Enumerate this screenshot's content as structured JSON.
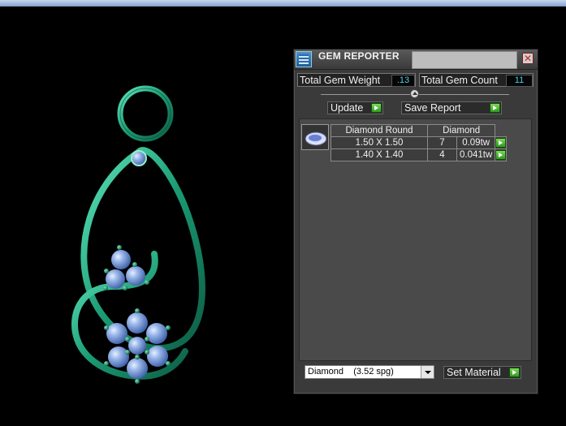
{
  "window": {
    "title": "GEM REPORTER",
    "close_glyph": "✕"
  },
  "stats": {
    "weight_label": "Total Gem Weight",
    "weight_value": ".13",
    "count_label": "Total Gem Count",
    "count_value": "11"
  },
  "toolbar": {
    "update_label": "Update",
    "save_report_label": "Save Report"
  },
  "gem_table": {
    "headers": [
      "Diamond Round",
      "Diamond"
    ],
    "rows": [
      {
        "size": "1.50 X 1.50",
        "count": "7",
        "weight": "0.09tw"
      },
      {
        "size": "1.40 X 1.40",
        "count": "4",
        "weight": "0.041tw"
      }
    ]
  },
  "material": {
    "selected": "Diamond    (3.52 spg)",
    "set_label": "Set Material"
  },
  "icons": [
    "gem-reporter-app-icon",
    "close-icon",
    "arrow-right-icon",
    "slider-knob-icon",
    "round-diamond-icon",
    "dropdown-arrow-icon"
  ],
  "colors": {
    "accent_value": "#47d1e6",
    "arrow_button": "#3fa830",
    "metal": "#1fa37a",
    "gem": "#7b9bd6"
  }
}
